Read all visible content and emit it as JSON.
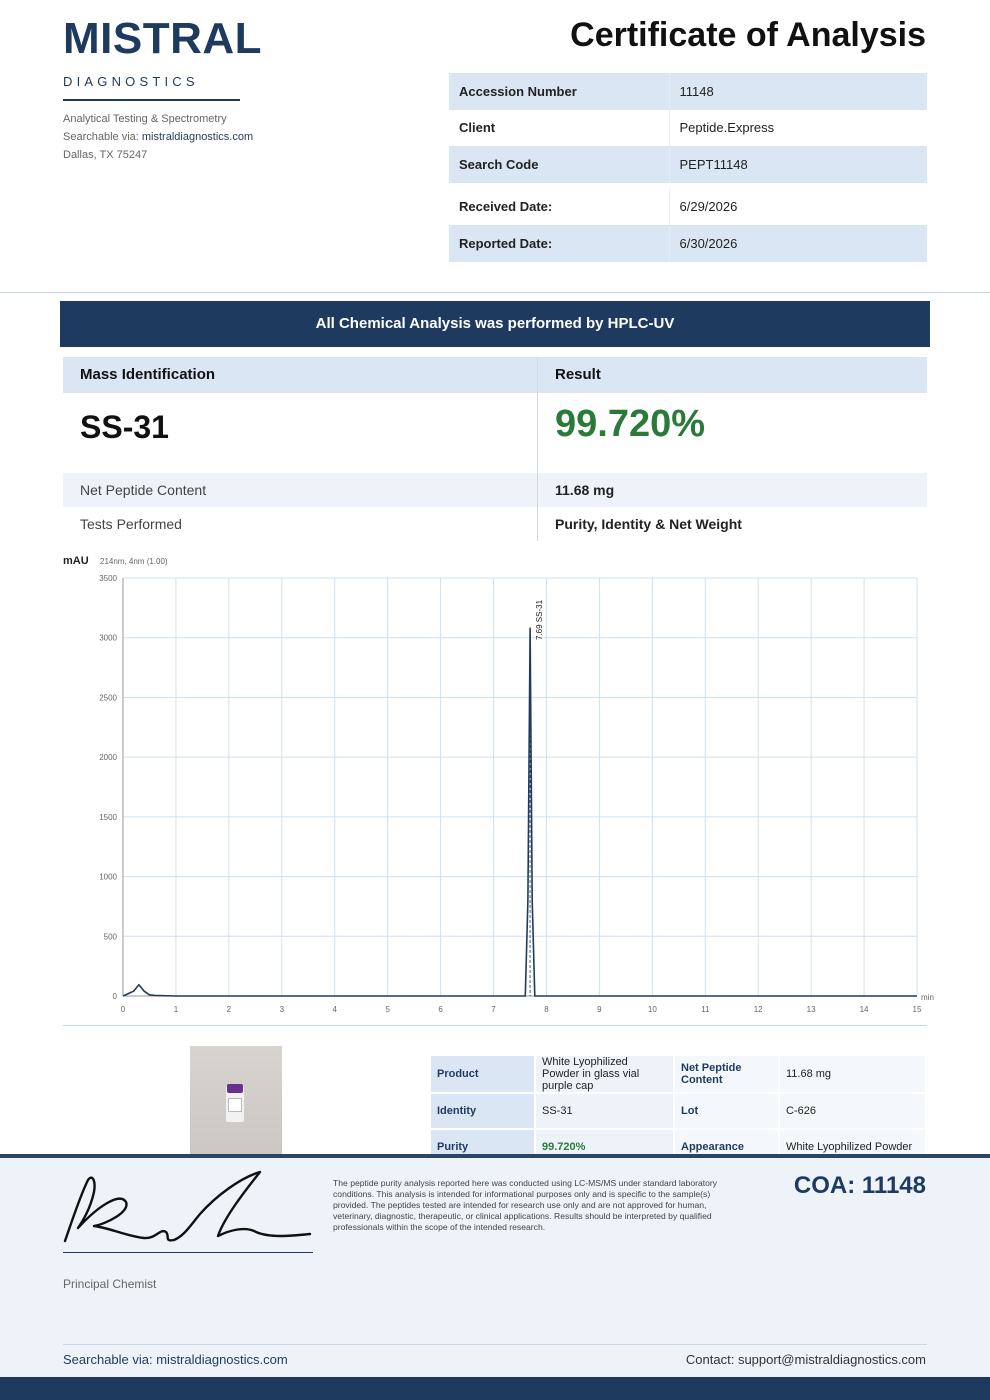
{
  "lab": {
    "name": "MISTRAL",
    "sub": "DIAGNOSTICS",
    "tagline": "Analytical Testing & Spectrometry",
    "searchable_prefix": "Searchable via: ",
    "website": "mistraldiagnostics.com",
    "address": "Dallas, TX 75247"
  },
  "title": "Certificate of Analysis",
  "meta": [
    {
      "label": "Accession Number",
      "value": "11148"
    },
    {
      "label": "Client",
      "value": "Peptide.Express"
    },
    {
      "label": "Search Code",
      "value": "PEPT11148"
    },
    {
      "label": "Received Date:",
      "value": "6/29/2026"
    },
    {
      "label": "Reported Date:",
      "value": "6/30/2026"
    }
  ],
  "banner": "All Chemical Analysis was performed by HPLC-UV",
  "results": {
    "head_left": "Mass Identification",
    "head_right": "Result",
    "compound": "SS-31",
    "purity": "99.720%",
    "rows": [
      {
        "label": "Net Peptide Content",
        "value": "11.68 mg"
      },
      {
        "label": "Tests Performed",
        "value": "Purity, Identity & Net Weight"
      }
    ]
  },
  "chart_data": {
    "type": "line",
    "ylabel": "mAU",
    "subtitle": "214nm, 4nm (1.00)",
    "xlabel": "min",
    "xlim": [
      0,
      15
    ],
    "ylim": [
      0,
      3500
    ],
    "x_ticks": [
      0,
      1,
      2,
      3,
      4,
      5,
      6,
      7,
      8,
      9,
      10,
      11,
      12,
      13,
      14,
      15
    ],
    "y_ticks": [
      0,
      500,
      1000,
      1500,
      2000,
      2500,
      3000,
      3500
    ],
    "grid": true,
    "series": [
      {
        "x": [
          0,
          0.2,
          0.3,
          0.4,
          0.5,
          0.6,
          1,
          7.6,
          7.65,
          7.69,
          7.73,
          7.78,
          15
        ],
        "y": [
          0,
          40,
          95,
          40,
          10,
          5,
          0,
          0,
          800,
          3080,
          800,
          0,
          0
        ],
        "color": "#1f3a5f"
      }
    ],
    "peaks": [
      {
        "x": 7.69,
        "label": "7.69 SS-31"
      }
    ]
  },
  "product": {
    "rows": [
      {
        "k1": "Product",
        "v1": "White Lyophilized Powder in glass vial purple cap",
        "k2": "Net Peptide Content",
        "v2": "11.68 mg"
      },
      {
        "k1": "Identity",
        "v1": "SS-31",
        "k2": "Lot",
        "v2": "C-626"
      },
      {
        "k1": "Purity",
        "v1": "99.720%",
        "k2": "Appearance",
        "v2": "White Lyophilized Powder"
      }
    ]
  },
  "footer": {
    "signer_title": "Principal Chemist",
    "disclaimer": "The peptide purity analysis reported here was conducted using LC-MS/MS under standard laboratory conditions. This analysis is intended for informational purposes only and is specific to the sample(s) provided. The peptides tested are intended for research use only and are not approved for human, veterinary, diagnostic, therapeutic, or clinical applications. Results should be interpreted by qualified professionals within the scope of the intended research.",
    "coa": "COA: 11148",
    "searchable": "Searchable via: mistraldiagnostics.com",
    "contact": "Contact: support@mistraldiagnostics.com"
  },
  "colors": {
    "brand": "#1f3a5f",
    "result_green": "#2a7a3a",
    "row_shade": "#dbe6f4"
  }
}
